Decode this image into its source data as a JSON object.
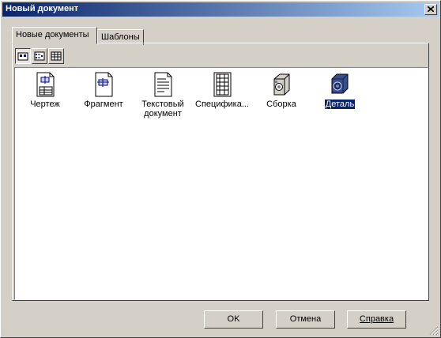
{
  "window": {
    "title": "Новый документ"
  },
  "tabs": [
    {
      "label": "Новые документы",
      "active": true
    },
    {
      "label": "Шаблоны",
      "active": false
    }
  ],
  "view_buttons": [
    {
      "icon": "large-icons-view-icon",
      "pressed": true
    },
    {
      "icon": "list-view-icon",
      "pressed": false
    },
    {
      "icon": "details-view-icon",
      "pressed": false
    }
  ],
  "items": [
    {
      "label": "Чертеж",
      "icon": "drawing-document-icon"
    },
    {
      "label": "Фрагмент",
      "icon": "fragment-document-icon"
    },
    {
      "label": "Текстовый документ",
      "icon": "text-document-icon"
    },
    {
      "label": "Специфика...",
      "icon": "specification-document-icon"
    },
    {
      "label": "Сборка",
      "icon": "assembly-document-icon"
    },
    {
      "label": "Деталь",
      "icon": "part-document-icon",
      "selected": true
    }
  ],
  "buttons": {
    "ok": "OK",
    "cancel": "Отмена",
    "help": "Справка"
  },
  "colors": {
    "titlebar_start": "#0a246a",
    "titlebar_end": "#a6caf0",
    "selection": "#0a246a",
    "face": "#d4d0c8"
  }
}
